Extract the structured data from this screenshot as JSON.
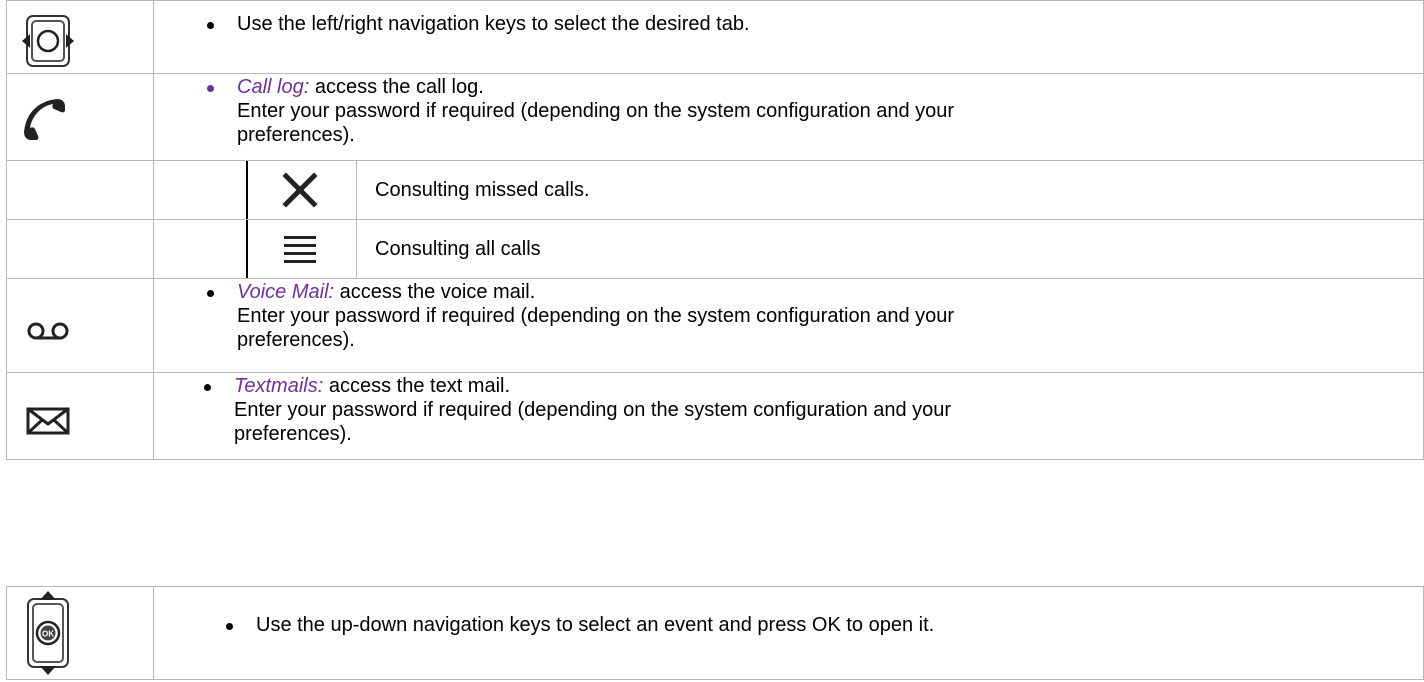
{
  "rows": {
    "tabs": {
      "text": "Use the left/right navigation keys to select the desired tab.",
      "icon": "left-right-navigation-key-icon"
    },
    "call_log": {
      "label": "Call log:",
      "text": " access the call log.",
      "line2": "Enter your password if required (depending on the system configuration and your",
      "line3": "preferences).",
      "icon": "phone-handset-icon"
    },
    "missed": {
      "text": "Consulting missed calls.",
      "icon": "cross-icon"
    },
    "all": {
      "text": "Consulting all calls",
      "icon": "list-icon"
    },
    "voice_mail": {
      "label": "Voice Mail:",
      "text": " access the voice mail.",
      "line2": "Enter your password if required (depending on the system configuration and your",
      "line3": "preferences).",
      "icon": "voicemail-icon"
    },
    "textmails": {
      "label": "Textmails:",
      "text": " access the text mail.",
      "line2": "Enter your password if required (depending on the system configuration and your",
      "line3": "preferences).",
      "icon": "envelope-icon"
    }
  },
  "second_table": {
    "text": "Use the up-down navigation keys to select an event and press OK to open it.",
    "ok_label": "OK",
    "icon": "up-down-ok-navigation-key-icon"
  },
  "colors": {
    "label_accent": "#7030a0",
    "border": "#b8b8b8"
  }
}
